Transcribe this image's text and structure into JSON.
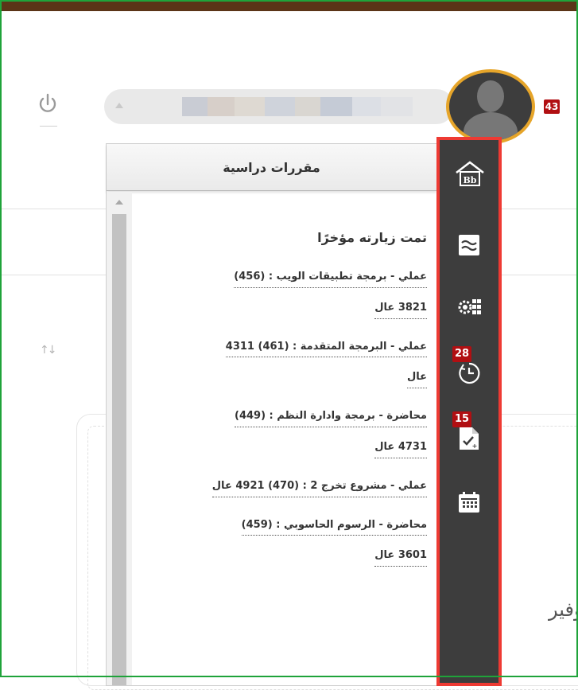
{
  "header": {
    "notification_count": "43"
  },
  "background": {
    "partial_text": "وفير"
  },
  "popup": {
    "title": "مقررات دراسية",
    "recent_title": "تمت زيارته مؤخرًا",
    "courses": [
      {
        "line1": "عملي - برمجة تطبيقات الويب : (456)",
        "line2": "3821 عال"
      },
      {
        "line1": "عملي - البرمجة المتقدمة : (461) 4311",
        "line2": "عال"
      },
      {
        "line1": "محاضرة - برمجة وادارة النظم : (449)",
        "line2": "4731 عال"
      },
      {
        "line1": "عملي - مشروع تخرج 2 : (470) 4921 عال",
        "line2": ""
      },
      {
        "line1": "محاضرة - الرسوم الحاسوبي : (459)",
        "line2": "3601 عال"
      }
    ]
  },
  "sidebar": {
    "items": [
      {
        "icon": "blackboard-home-icon",
        "badge": ""
      },
      {
        "icon": "stream-icon",
        "badge": ""
      },
      {
        "icon": "gear-grid-icon",
        "badge": ""
      },
      {
        "icon": "clock-icon",
        "badge": "28"
      },
      {
        "icon": "graded-document-icon",
        "badge": "15"
      },
      {
        "icon": "calendar-icon",
        "badge": ""
      }
    ]
  },
  "colors": {
    "topbar": "#5a3417",
    "sidebar_bg": "#3d3d3d",
    "sidebar_highlight": "#ee3a33",
    "badge": "#b10f12",
    "avatar_ring": "#e6a52a",
    "frame": "#1fa33a"
  }
}
